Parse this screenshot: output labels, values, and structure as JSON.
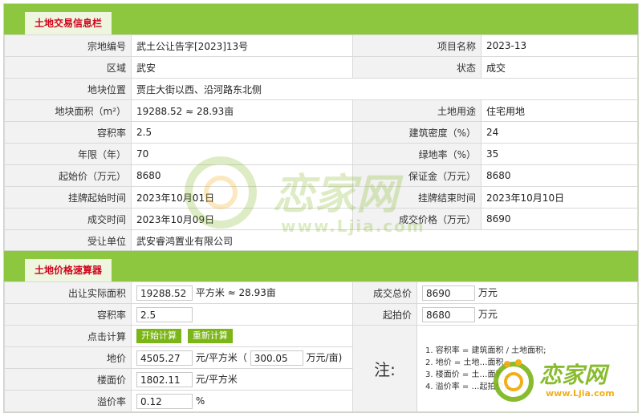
{
  "info": {
    "title": "土地交易信息栏",
    "rows": [
      {
        "l1": "宗地编号",
        "v1": "武土公让告字[2023]13号",
        "l2": "项目名称",
        "v2": "2023-13"
      },
      {
        "l1": "区域",
        "v1": "武安",
        "l2": "状态",
        "v2": "成交"
      },
      {
        "l1": "地块位置",
        "v1": "贾庄大街以西、沿河路东北侧"
      },
      {
        "l1": "地块面积（m²）",
        "v1": "19288.52 ≈ 28.93亩",
        "l2": "土地用途",
        "v2": "住宅用地"
      },
      {
        "l1": "容积率",
        "v1": "2.5",
        "l2": "建筑密度（%）",
        "v2": "24"
      },
      {
        "l1": "年限（年）",
        "v1": "70",
        "l2": "绿地率（%）",
        "v2": "35"
      },
      {
        "l1": "起始价（万元）",
        "v1": "8680",
        "l2": "保证金（万元）",
        "v2": "8680"
      },
      {
        "l1": "挂牌起始时间",
        "v1": "2023年10月01日",
        "l2": "挂牌结束时间",
        "v2": "2023年10月10日"
      },
      {
        "l1": "成交时间",
        "v1": "2023年10月09日",
        "l2": "成交价格（万元）",
        "v2": "8690"
      },
      {
        "l1": "受让单位",
        "v1": "武安睿鸿置业有限公司"
      }
    ]
  },
  "calc": {
    "title": "土地价格速算器",
    "area_label": "出让实际面积",
    "area_value": "19288.52",
    "area_unit": "平方米 ≈ 28.93亩",
    "total_label": "成交总价",
    "total_value": "8690",
    "total_unit": "万元",
    "far_label": "容积率",
    "far_value": "2.5",
    "start_label": "起拍价",
    "start_value": "8680",
    "start_unit": "万元",
    "click_label": "点击计算",
    "btn_start": "开始计算",
    "btn_reset": "重新计算",
    "land_price_label": "地价",
    "land_price_value": "4505.27",
    "land_price_unit1": "元/平方米（",
    "land_price_mu": "300.05",
    "land_price_unit2": "万元/亩)",
    "floor_price_label": "楼面价",
    "floor_price_value": "1802.11",
    "floor_price_unit": "元/平方米",
    "premium_label": "溢价率",
    "premium_value": "0.12",
    "premium_unit": "%",
    "note_title": "注:",
    "notes": [
      "1. 容积率 = 建筑面积 / 土地面积;",
      "2. 地价 = 土地…面积…",
      "3. 楼面价 = 土…面积…",
      "4. 溢价率 = …起拍价…"
    ]
  },
  "watermark": {
    "brand": "恋家网",
    "url": "www.Ljia.com"
  },
  "colors": {
    "bar": "#8dc63f",
    "tab_text": "#d0021b",
    "button": "#7cb518"
  }
}
